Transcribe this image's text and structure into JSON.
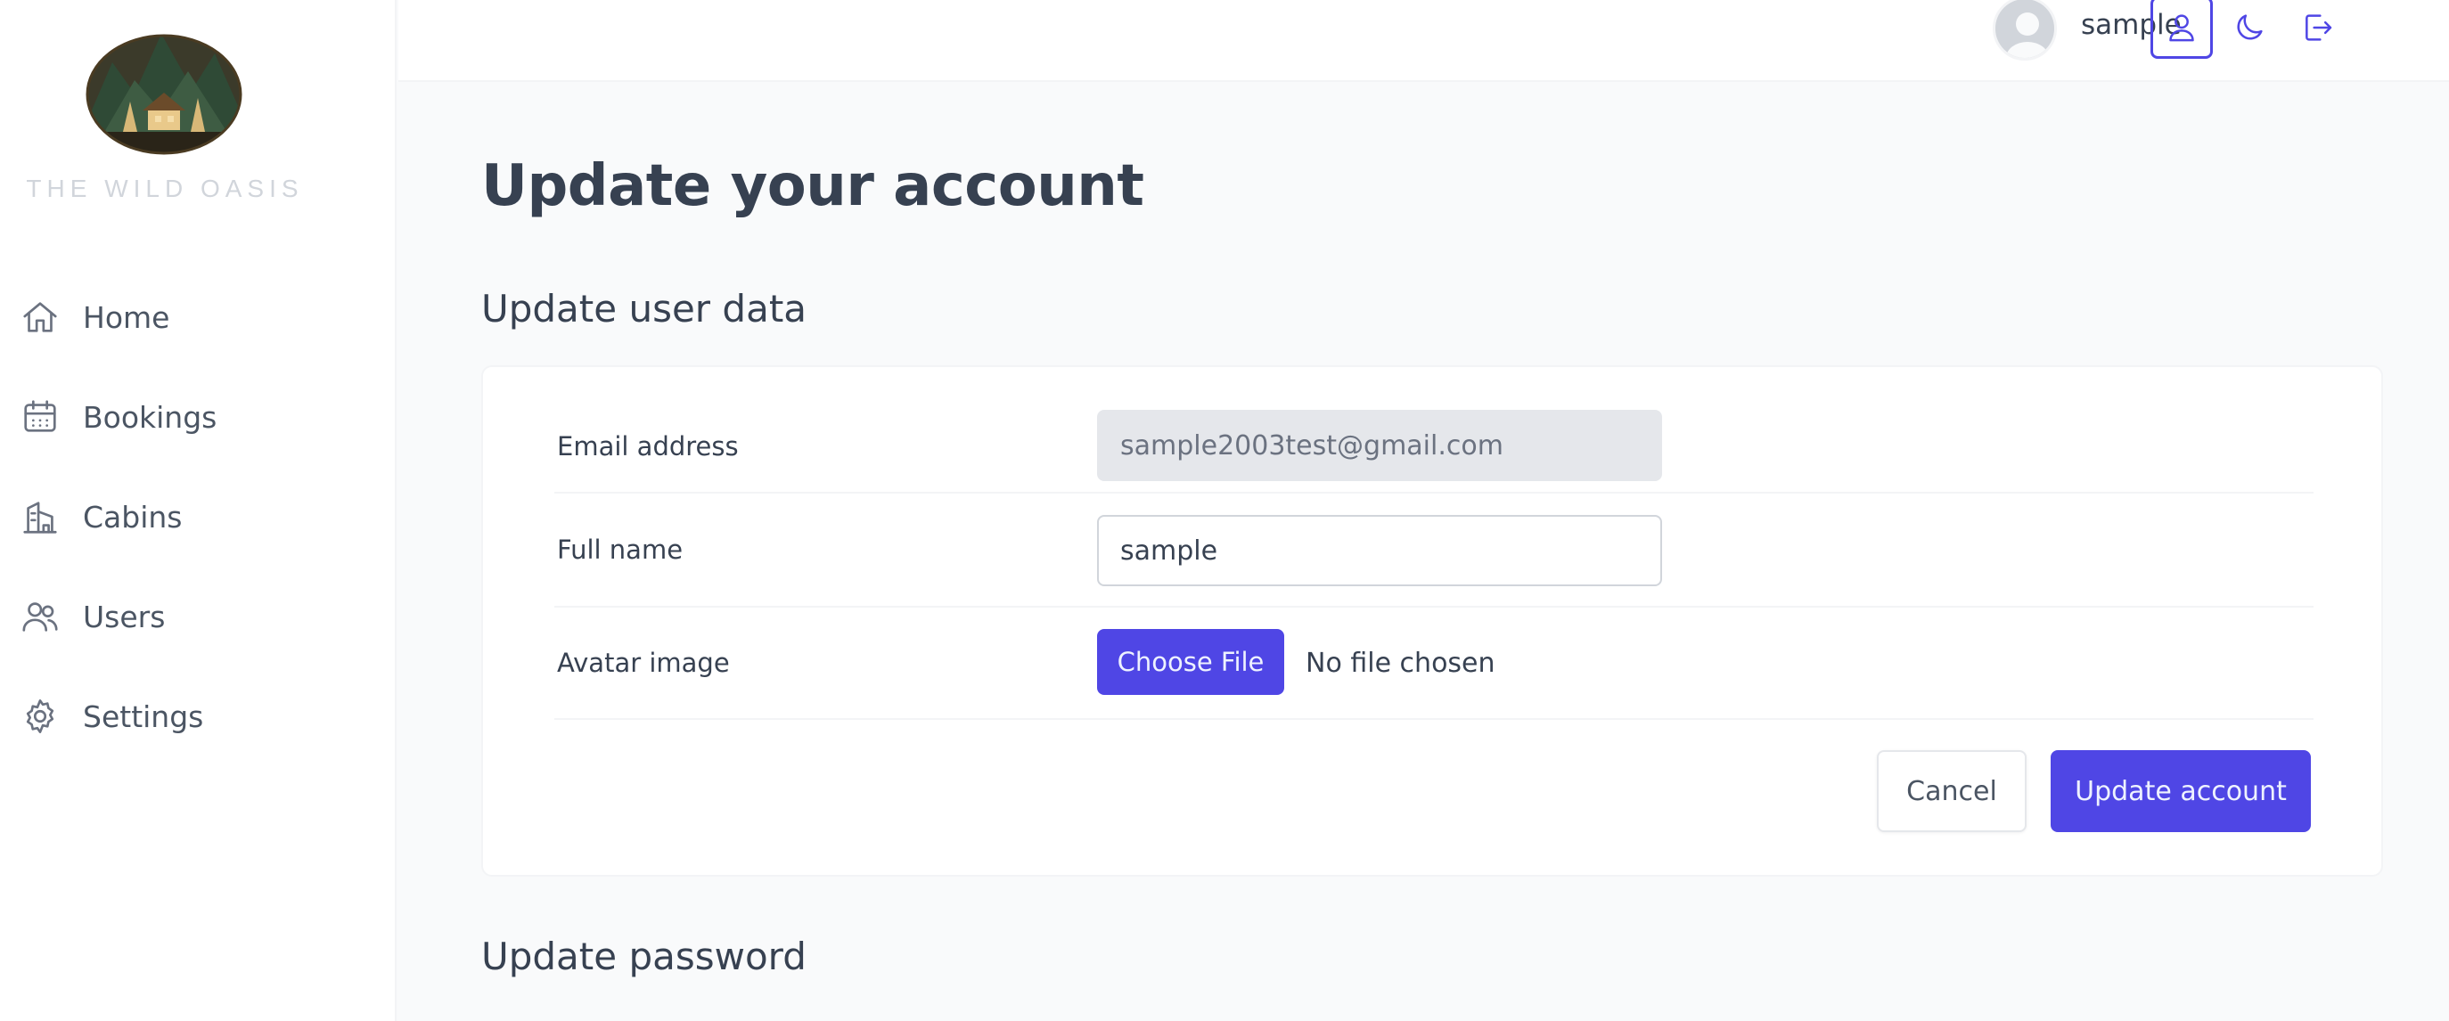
{
  "brand": {
    "name": "The Wild Oasis"
  },
  "sidebar": {
    "items": [
      {
        "label": "Home",
        "icon": "home-icon"
      },
      {
        "label": "Bookings",
        "icon": "calendar-icon"
      },
      {
        "label": "Cabins",
        "icon": "building-icon"
      },
      {
        "label": "Users",
        "icon": "users-icon"
      },
      {
        "label": "Settings",
        "icon": "gear-icon"
      }
    ]
  },
  "header": {
    "user_name": "sample",
    "buttons": [
      "account-icon",
      "moon-icon",
      "logout-icon"
    ]
  },
  "main": {
    "title": "Update your account",
    "user_section": {
      "title": "Update user data",
      "email_label": "Email address",
      "email_value": "sample2003test@gmail.com",
      "fullname_label": "Full name",
      "fullname_value": "sample",
      "avatar_label": "Avatar image",
      "file_button": "Choose File",
      "file_status": "No file chosen",
      "cancel_label": "Cancel",
      "submit_label": "Update account"
    },
    "password_section": {
      "title": "Update password"
    }
  },
  "colors": {
    "accent": "#4f46e5",
    "background": "#f9fafb",
    "text": "#374151"
  }
}
